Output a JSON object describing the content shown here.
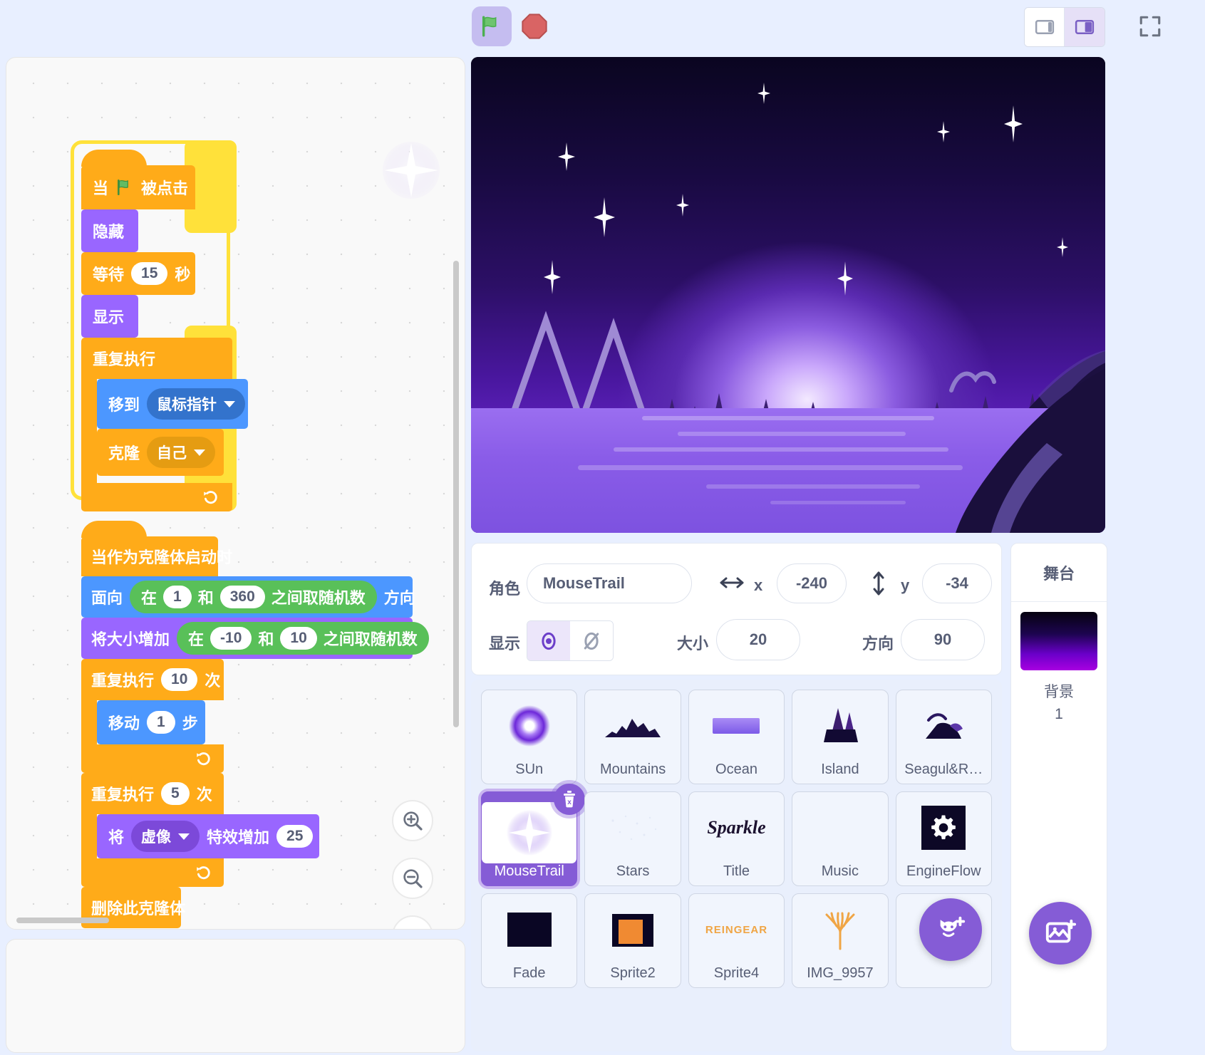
{
  "toolbar": {
    "green_flag_label": "green-flag",
    "stop_label": "stop",
    "layout_small_label": "small-stage-layout",
    "layout_large_label": "large-stage-layout",
    "fullscreen_label": "fullscreen"
  },
  "scripts": [
    {
      "id": "script-1",
      "running": true,
      "blocks": [
        {
          "type": "hat",
          "category": "control",
          "text_before": "当",
          "icon": "green-flag-icon",
          "text_after": "被点击"
        },
        {
          "type": "stack",
          "category": "looks",
          "label": "隐藏"
        },
        {
          "type": "stack",
          "category": "control",
          "label_before": "等待",
          "value": "15",
          "label_after": "秒"
        },
        {
          "type": "stack",
          "category": "looks",
          "label": "显示"
        },
        {
          "type": "c-block",
          "category": "control",
          "label": "重复执行",
          "children": [
            {
              "type": "stack",
              "category": "motion",
              "label": "移到",
              "dropdown": "鼠标指针"
            },
            {
              "type": "stack",
              "category": "control",
              "label": "克隆",
              "dropdown": "自己"
            }
          ]
        }
      ]
    },
    {
      "id": "script-2",
      "running": false,
      "blocks": [
        {
          "type": "hat",
          "category": "control",
          "label": "当作为克隆体启动时"
        },
        {
          "type": "stack",
          "category": "motion",
          "label_before": "面向",
          "operator": {
            "category": "operator",
            "label_before": "在",
            "from": "1",
            "label_mid": "和",
            "to": "360",
            "label_after": "之间取随机数"
          },
          "label_after": "方向"
        },
        {
          "type": "stack",
          "category": "looks",
          "label_before": "将大小增加",
          "operator": {
            "category": "operator",
            "label_before": "在",
            "from": "-10",
            "label_mid": "和",
            "to": "10",
            "label_after": "之间取随机数"
          }
        },
        {
          "type": "c-block",
          "category": "control",
          "label_before": "重复执行",
          "value": "10",
          "label_after": "次",
          "children": [
            {
              "type": "stack",
              "category": "motion",
              "label_before": "移动",
              "value": "1",
              "label_after": "步"
            }
          ]
        },
        {
          "type": "c-block",
          "category": "control",
          "label_before": "重复执行",
          "value": "5",
          "label_after": "次",
          "children": [
            {
              "type": "stack",
              "category": "looks",
              "label_before": "将",
              "dropdown": "虚像",
              "label_mid": "特效增加",
              "value": "25"
            }
          ]
        },
        {
          "type": "stack",
          "category": "control",
          "label": "删除此克隆体"
        }
      ]
    }
  ],
  "sprite_info": {
    "name_label": "角色",
    "name_value": "MouseTrail",
    "x_label": "x",
    "x_value": "-240",
    "y_label": "y",
    "y_value": "-34",
    "show_label": "显示",
    "size_label": "大小",
    "size_value": "20",
    "direction_label": "方向",
    "direction_value": "90"
  },
  "sprites": [
    {
      "name": "SUn",
      "thumb": "glow-orb-icon",
      "selected": false
    },
    {
      "name": "Mountains",
      "thumb": "mountain-range-icon",
      "selected": false
    },
    {
      "name": "Ocean",
      "thumb": "ocean-strip-icon",
      "selected": false
    },
    {
      "name": "Island",
      "thumb": "island-peaks-icon",
      "selected": false
    },
    {
      "name": "Seagul&R…",
      "thumb": "seagull-rock-icon",
      "selected": false
    },
    {
      "name": "MouseTrail",
      "thumb": "sparkle-icon",
      "selected": true
    },
    {
      "name": "Stars",
      "thumb": "stars-icon",
      "selected": false
    },
    {
      "name": "Title",
      "thumb": "sparkle-wordmark-icon",
      "selected": false
    },
    {
      "name": "Music",
      "thumb": "blank-icon",
      "selected": false
    },
    {
      "name": "EngineFlow",
      "thumb": "gear-dark-icon",
      "selected": false
    },
    {
      "name": "Fade",
      "thumb": "dark-square-icon",
      "selected": false
    },
    {
      "name": "Sprite2",
      "thumb": "orange-window-icon",
      "selected": false
    },
    {
      "name": "Sprite4",
      "thumb": "reingear-wordmark-icon",
      "selected": false
    },
    {
      "name": "IMG_9957",
      "thumb": "deer-antler-icon",
      "selected": false
    },
    {
      "name": "",
      "thumb": "blank-icon",
      "selected": false
    }
  ],
  "sprite_delete_badge": "delete-sprite-icon",
  "stage_panel": {
    "title": "舞台",
    "backdrop_label": "背景",
    "backdrop_count": "1"
  },
  "fabs": {
    "add_sprite": "add-sprite-icon",
    "add_backdrop": "add-backdrop-icon"
  },
  "zoom_controls": {
    "zoom_in": "zoom-in-icon",
    "zoom_out": "zoom-out-icon",
    "zoom_reset": "zoom-reset-icon"
  },
  "colors": {
    "motion": "#4c97ff",
    "looks": "#9966ff",
    "control": "#ffab19",
    "operator": "#59c059",
    "accent": "#855cd6",
    "page_bg": "#e8efff"
  }
}
